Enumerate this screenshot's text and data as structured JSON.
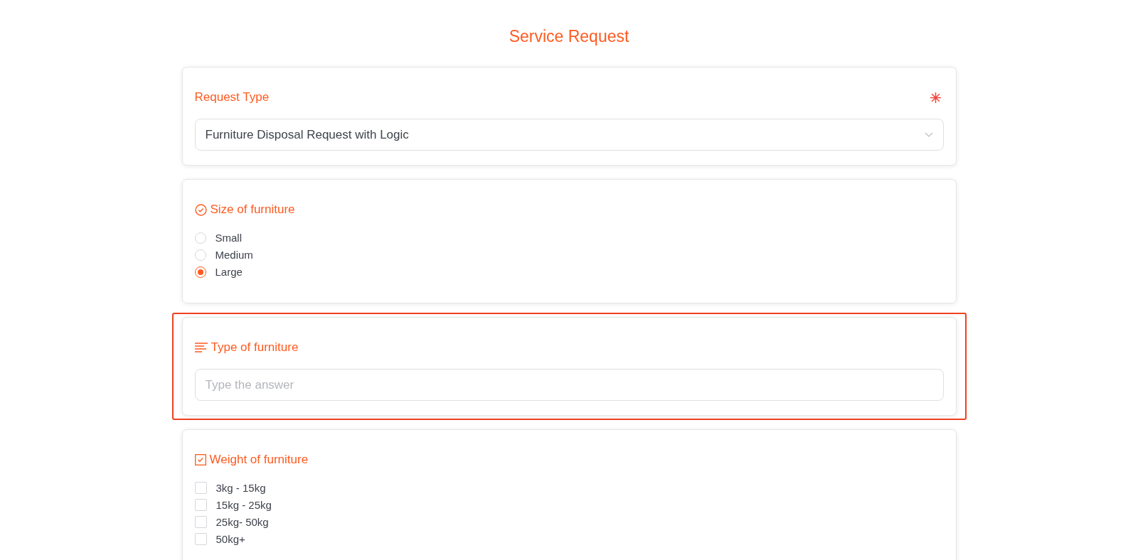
{
  "page": {
    "title": "Service Request"
  },
  "questions": [
    {
      "kind": "select",
      "label": "Request Type",
      "required": true,
      "selected": false,
      "value": "Furniture Disposal Request with Logic"
    },
    {
      "kind": "radio",
      "label": "Size of furniture",
      "required": false,
      "selected": false,
      "options": [
        {
          "label": "Small",
          "selected": false
        },
        {
          "label": "Medium",
          "selected": false
        },
        {
          "label": "Large",
          "selected": true
        }
      ]
    },
    {
      "kind": "text",
      "label": "Type of furniture",
      "required": false,
      "selected": true,
      "placeholder": "Type the answer"
    },
    {
      "kind": "checkbox",
      "label": "Weight of furniture",
      "required": false,
      "selected": false,
      "options": [
        {
          "label": "3kg - 15kg",
          "checked": false
        },
        {
          "label": "15kg - 25kg",
          "checked": false
        },
        {
          "label": "25kg- 50kg",
          "checked": false
        },
        {
          "label": "50kg+",
          "checked": false
        }
      ]
    }
  ]
}
